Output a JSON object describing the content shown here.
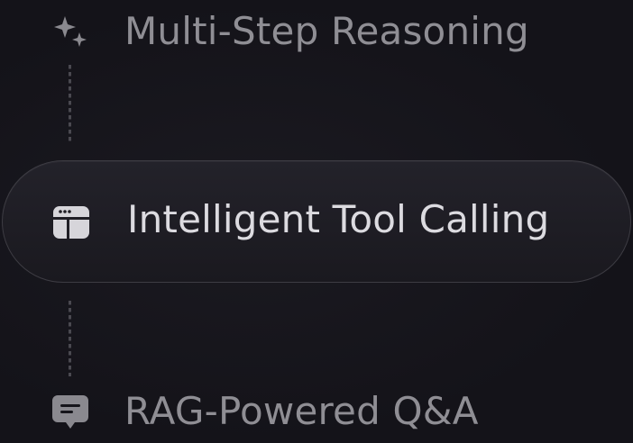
{
  "steps": [
    {
      "label": "Multi-Step Reasoning",
      "icon": "sparkles-icon",
      "state": "inactive"
    },
    {
      "label": "Intelligent Tool Calling",
      "icon": "tool-window-icon",
      "state": "active"
    },
    {
      "label": "RAG-Powered Q&A",
      "icon": "chat-bubble-icon",
      "state": "inactive"
    }
  ],
  "colors": {
    "background": "#16151b",
    "active_border": "#3d3c43",
    "active_text": "#dcdbe0",
    "inactive_text": "#8f8e94",
    "icon_active": "#d6d5da",
    "icon_inactive": "#8a898f"
  }
}
